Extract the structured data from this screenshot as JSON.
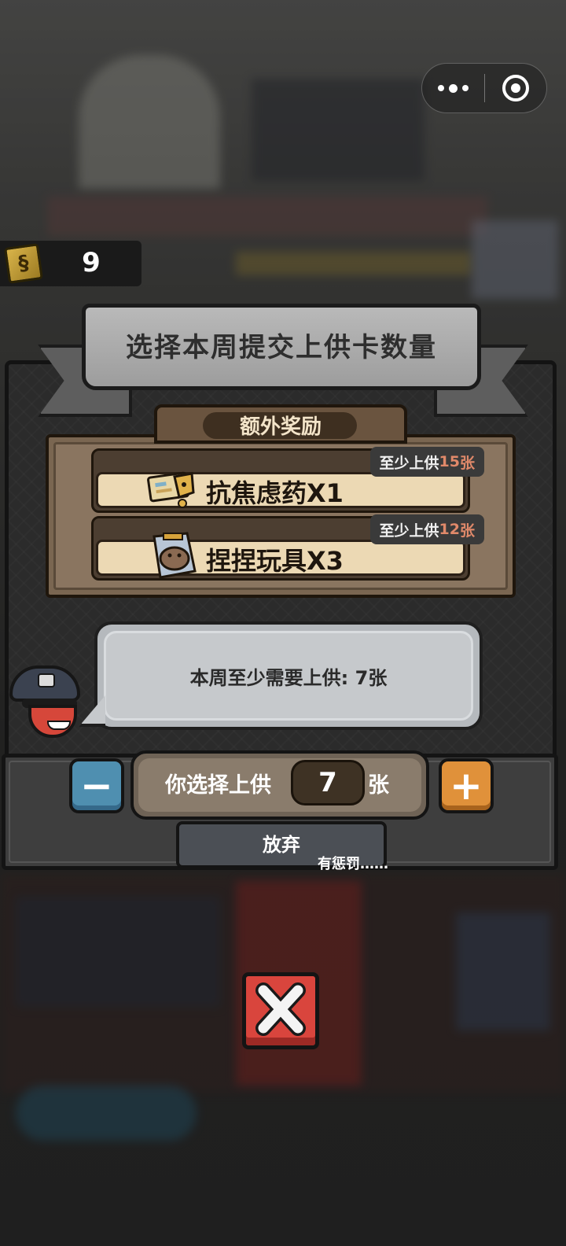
{
  "header": {
    "card_count": "9",
    "title": "选择本周提交上供卡数量"
  },
  "bonus": {
    "label": "额外奖励",
    "rewards": [
      {
        "name": "抗焦虑药X1",
        "req_prefix": "至少上供",
        "req_num": "15",
        "req_unit": "张",
        "icon": "medicine-pack-icon"
      },
      {
        "name": "捏捏玩具X3",
        "req_prefix": "至少上供",
        "req_num": "12",
        "req_unit": "张",
        "icon": "squeeze-toy-icon"
      }
    ]
  },
  "dialog": {
    "message": "本周至少需要上供: 7张"
  },
  "stepper": {
    "label": "你选择上供",
    "value": "7",
    "unit": "张",
    "minus": "−",
    "plus": "+"
  },
  "give_up": {
    "label": "放弃",
    "note": "有惩罚……"
  },
  "colors": {
    "minus_button": "#4f8fb0",
    "plus_button": "#e0913a",
    "close_button": "#d9453d",
    "requirement_number": "#e0896a"
  }
}
